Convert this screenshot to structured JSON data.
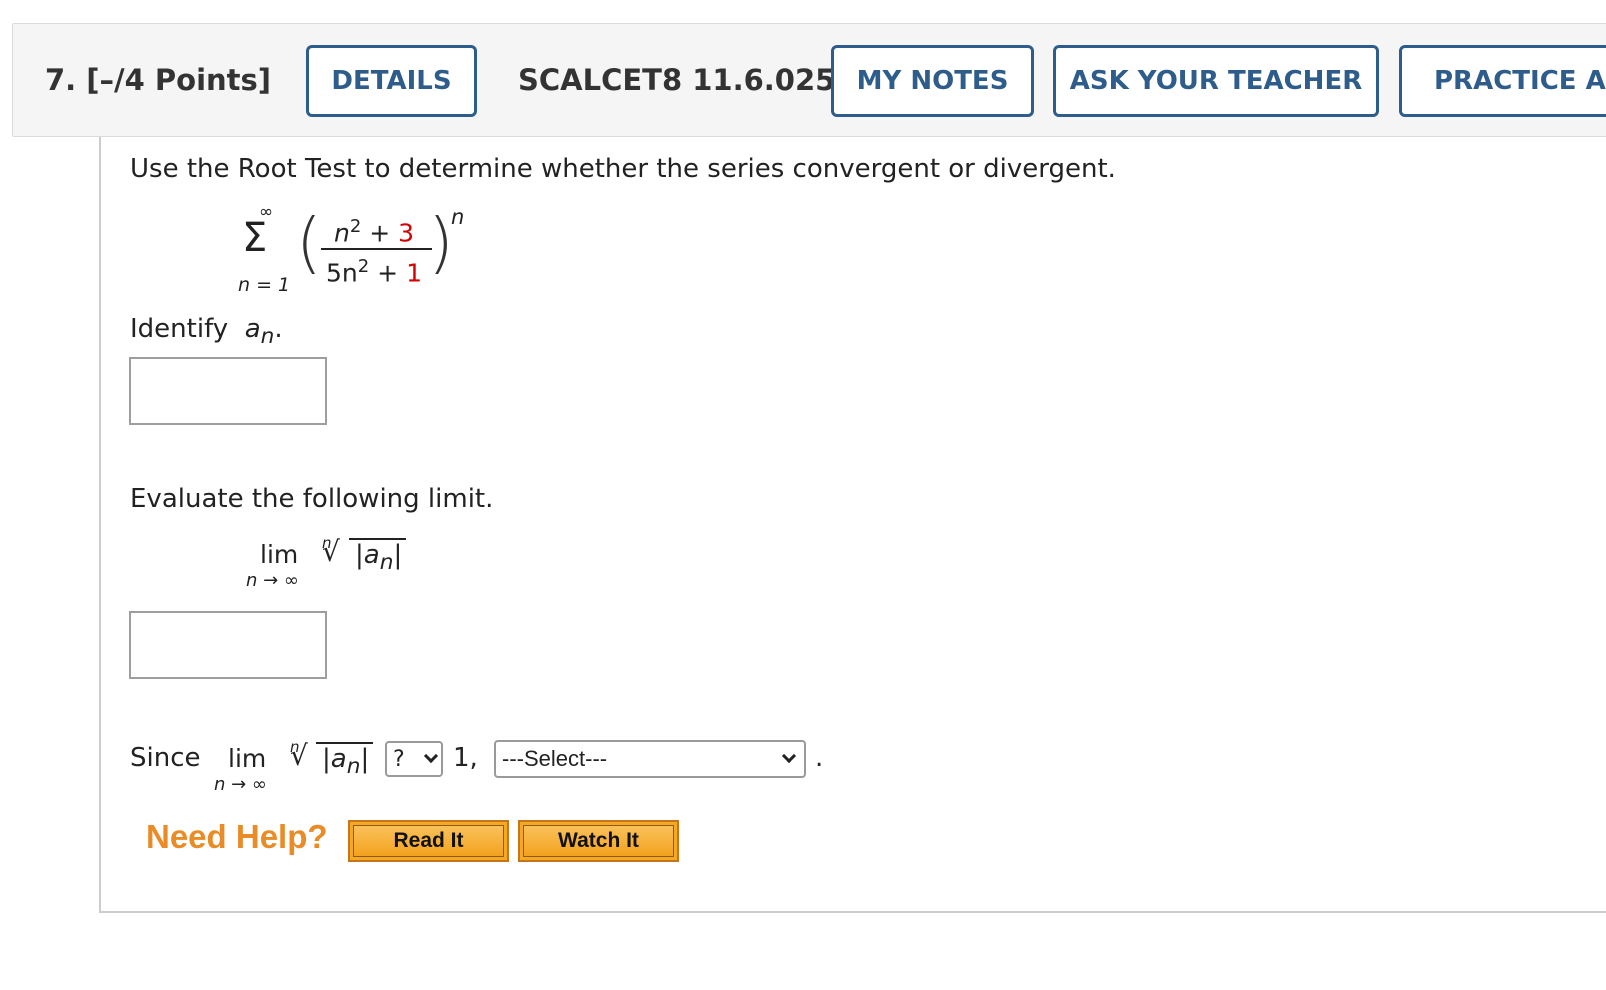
{
  "header": {
    "question_label": "7. [–/4 Points]",
    "details_label": "DETAILS",
    "assignment_code": "SCALCET8 11.6.025.",
    "my_notes_label": "MY NOTES",
    "ask_teacher_label": "ASK YOUR TEACHER",
    "practice_label": "PRACTICE ANOTHER"
  },
  "question": {
    "prompt": "Use the Root Test to determine whether the series convergent or divergent.",
    "series": {
      "sigma": "Σ",
      "upper_limit": "∞",
      "lower_limit": "n = 1",
      "numerator_var": "n",
      "numerator_exp": "2",
      "numerator_op": " + ",
      "numerator_const": "3",
      "denominator_coef": "5n",
      "denominator_exp": "2",
      "denominator_op": " + ",
      "denominator_const": "1",
      "outer_exponent": "n",
      "left_paren": "(",
      "right_paren": ")"
    },
    "identify_text": "Identify",
    "identify_var": "a",
    "identify_sub": "n",
    "identify_period": ".",
    "answer1_value": "",
    "evaluate_text": "Evaluate the following limit.",
    "limit": {
      "lim": "lim",
      "under": "n → ∞",
      "root_index": "n",
      "radical": "√",
      "abs_open": "|a",
      "abs_sub": "n",
      "abs_close": "|"
    },
    "answer2_value": "",
    "since_text": "Since",
    "comparison_select_value": "?",
    "one_text": "1,",
    "conclusion_select_value": "---Select---",
    "period_text": "."
  },
  "help": {
    "need_help": "Need Help?",
    "read_it": "Read It",
    "watch_it": "Watch It"
  },
  "colors": {
    "button_border": "#2e5d8c",
    "highlight_red": "#d40000",
    "need_help_orange": "#e98c27",
    "help_button_fill": "#f6a823"
  }
}
